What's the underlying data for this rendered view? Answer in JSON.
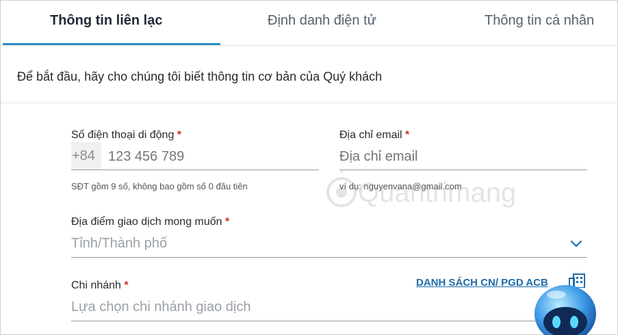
{
  "tabs": [
    {
      "label": "Thông tin liên lạc",
      "active": true
    },
    {
      "label": "Định danh điện tử",
      "active": false
    },
    {
      "label": "Thông tin cá nhân",
      "active": false
    }
  ],
  "intro": "Để bắt đầu, hãy cho chúng tôi biết thông tin cơ bản của Quý khách",
  "required_mark": "*",
  "phone": {
    "label": "Số điện thoại di động",
    "prefix": "+84",
    "placeholder": "123 456 789",
    "helper": "SĐT gồm 9 số, không bao gồm số 0 đầu tiên"
  },
  "email": {
    "label": "Địa chỉ email",
    "placeholder": "Địa chỉ email",
    "helper": "ví dụ: nguyenvana@gmail.com"
  },
  "location": {
    "label": "Địa điểm giao dịch mong muốn",
    "placeholder": "Tỉnh/Thành phố",
    "icon": "chevron-down-icon"
  },
  "branch": {
    "label": "Chi nhánh",
    "placeholder": "Lựa chọn chi nhánh giao dịch",
    "link_label": "DANH SÁCH CN/ PGD ACB",
    "icon": "building-icon"
  },
  "watermark": "Quantrimang",
  "colors": {
    "accent": "#2a8fc9",
    "link": "#1e6ba8",
    "required": "#d0312d"
  }
}
